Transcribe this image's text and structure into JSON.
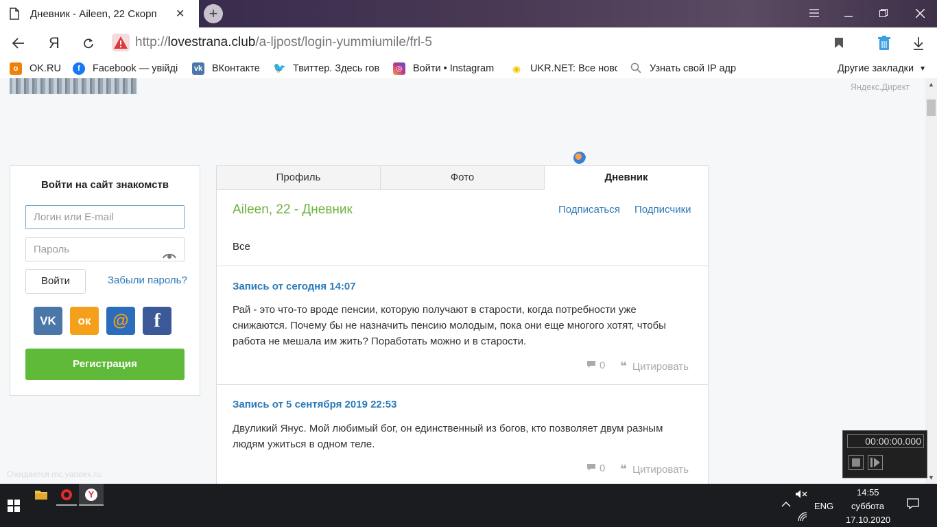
{
  "browser": {
    "tab_title": "Дневник - Aileen, 22 Скорп",
    "tab_close": "✕",
    "new_tab": "+",
    "url_prefix": "http://",
    "url_host": "lovestrana.club",
    "url_path": "/a-ljpost/login-yummiumile/frl-5",
    "yandex_letter": "Я"
  },
  "bookmarks": {
    "items": [
      {
        "label": "OK.RU",
        "icon": "ok-icon",
        "color": "#ee8208"
      },
      {
        "label": "Facebook — увійді",
        "icon": "facebook-icon",
        "color": "#1877f2"
      },
      {
        "label": "ВКонтакте",
        "icon": "vk-icon",
        "color": "#4a76a8"
      },
      {
        "label": "Твиттер. Здесь гов",
        "icon": "twitter-icon",
        "color": "#1da1f2"
      },
      {
        "label": "Войти • Instagram",
        "icon": "instagram-icon",
        "color": "#c13584"
      },
      {
        "label": "UKR.NET: Все новс",
        "icon": "ukrnet-icon",
        "color": "#f5c400"
      },
      {
        "label": "Узнать свой IP адр",
        "icon": "search-icon",
        "color": "#777777"
      }
    ],
    "other": "Другие закладки"
  },
  "page": {
    "yandex_direct": "Яндекс.Директ",
    "status_ghost": "Ожидается mc.yandex.ru"
  },
  "login": {
    "heading": "Войти на сайт знакомств",
    "login_placeholder": "Логин или E-mail",
    "password_placeholder": "Пароль",
    "submit": "Войти",
    "forgot": "Забыли пароль?",
    "register": "Регистрация",
    "social": [
      {
        "name": "vk",
        "glyph": "VK",
        "color": "#4a76a8"
      },
      {
        "name": "ok",
        "glyph": "ок",
        "color": "#f5a01a"
      },
      {
        "name": "mail",
        "glyph": "@",
        "color": "#2b6dbb"
      },
      {
        "name": "facebook",
        "glyph": "f",
        "color": "#3b5998"
      }
    ]
  },
  "profile": {
    "tabs": [
      "Профиль",
      "Фото",
      "Дневник"
    ],
    "active_tab": "Дневник",
    "title": "Aileen, 22 - Дневник",
    "subscribe": "Подписаться",
    "subscribers": "Подписчики",
    "filter": "Все",
    "entries": [
      {
        "title": "Запись от сегодня 14:07",
        "text": "Рай - это что-то вроде пенсии, которую получают в старости, когда потребности уже снижаются. Почему бы не назначить пенсию молодым, пока они еще многого хотят, чтобы работа не мешала им жить? Поработать можно и в старости.",
        "comments": "0",
        "quote": "Цитировать"
      },
      {
        "title": "Запись от 5 сентября 2019 22:53",
        "text": "Двуликий Янус. Мой любимый бог, он единственный из богов, кто позволяет двум разным людям ужиться в одном теле.",
        "comments": "0",
        "quote": "Цитировать"
      }
    ]
  },
  "video_widget": {
    "time": "00:00:00.000"
  },
  "taskbar": {
    "lang": "ENG",
    "time": "14:55",
    "day": "суббота",
    "date": "17.10.2020"
  },
  "colors": {
    "accent_green": "#6cb33f",
    "link_blue": "#2a7ab8",
    "register_green": "#5fba3a"
  }
}
